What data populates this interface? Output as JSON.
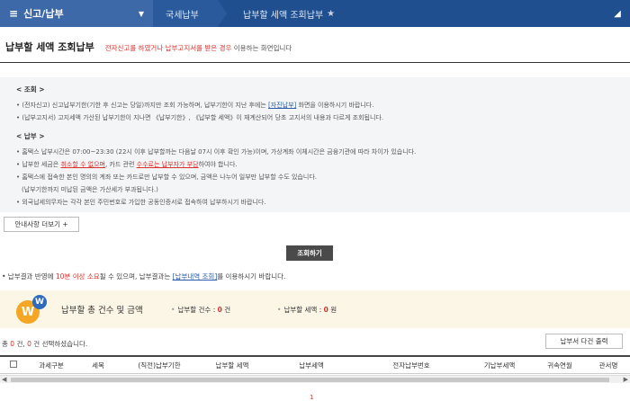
{
  "header": {
    "menu_label": "신고/납부",
    "crumbs": [
      "국세납부",
      "납부할 세액 조회납부"
    ]
  },
  "page": {
    "title": "납부할 세액 조회납부",
    "desc_red": "전자신고를 하였거나 납부고지서를 받은 경우",
    "desc_rest": "이용하는 화면입니다"
  },
  "notice": {
    "section1_title": "< 조회 >",
    "l1_a": "• (전자신고) 신고납부기한(기한 후 신고는 당일)까지만 조회 가능하며, 납부기한이 지난 후에는 ",
    "l1_link": "[자진납부]",
    "l1_b": " 화면을 이용하시기 바랍니다.",
    "l2": "• (납부고지서) 고지세액 가산된 납부기한이 지나면 《납부기한》, 《납부할 세액》이 재계산되어 당초 고지서의 내용과 다르게 조회됩니다.",
    "section2_title": "< 납부 >",
    "l3": "• 홈택스 납부시간은 07:00~23:30 (22시 이후 납부할까는 다음날 07시 이후 확인 가능)이며, 가상계좌 이체시간은 금융기관에 따라 차이가 있습니다.",
    "l4_a": "• 납부한 세금은 ",
    "l4_r1": "취소할 수 없으며",
    "l4_b": ", 카드 관련 ",
    "l4_r2": "수수료는 납부자가 부담",
    "l4_c": "하여야 합니다.",
    "l5": "• 홈택스에 접속한 본인 명의의 계좌 또는 카드로만 납부할 수 있으며, 금액은 나누어 일부만 납부할 수도 있습니다.",
    "l5_sub": "(납부기한까지 미납된 금액은 가산세가 부과됩니다.)",
    "l6": "• 외국납세의무자는 각각 본인 주민번호로 가입한 공동인증서로 접속하여 납부하시기 바랍니다."
  },
  "buttons": {
    "more": "안내사항 더보기 +",
    "query": "조회하기",
    "print": "납부서 다건 출력"
  },
  "info": {
    "a": "• 납부결과 반영에 ",
    "r": "10분 이상 소요",
    "b": "될 수 있으며, 납부결과는 ",
    "link": "[납부내역 조회]",
    "c": "를 이용하시기 바랍니다."
  },
  "summary": {
    "title": "납부할 총 건수 및 금액",
    "count_label": "납부할 건수 : ",
    "count_value": "0",
    "count_unit": " 건",
    "amount_label": "납부할 세액 : ",
    "amount_value": "0",
    "amount_unit": " 원"
  },
  "count_line": {
    "a": "총 ",
    "total": "0",
    "b": " 건, ",
    "selected": "0",
    "c": " 건 선택하셨습니다."
  },
  "table": {
    "headers": [
      "과세구분",
      "세목",
      "(직전)납부기한",
      "납부할 세액",
      "납부세액",
      "전자납부번호",
      "기납부세액",
      "귀속연월",
      "관서명"
    ]
  },
  "pager": {
    "current": "1"
  }
}
